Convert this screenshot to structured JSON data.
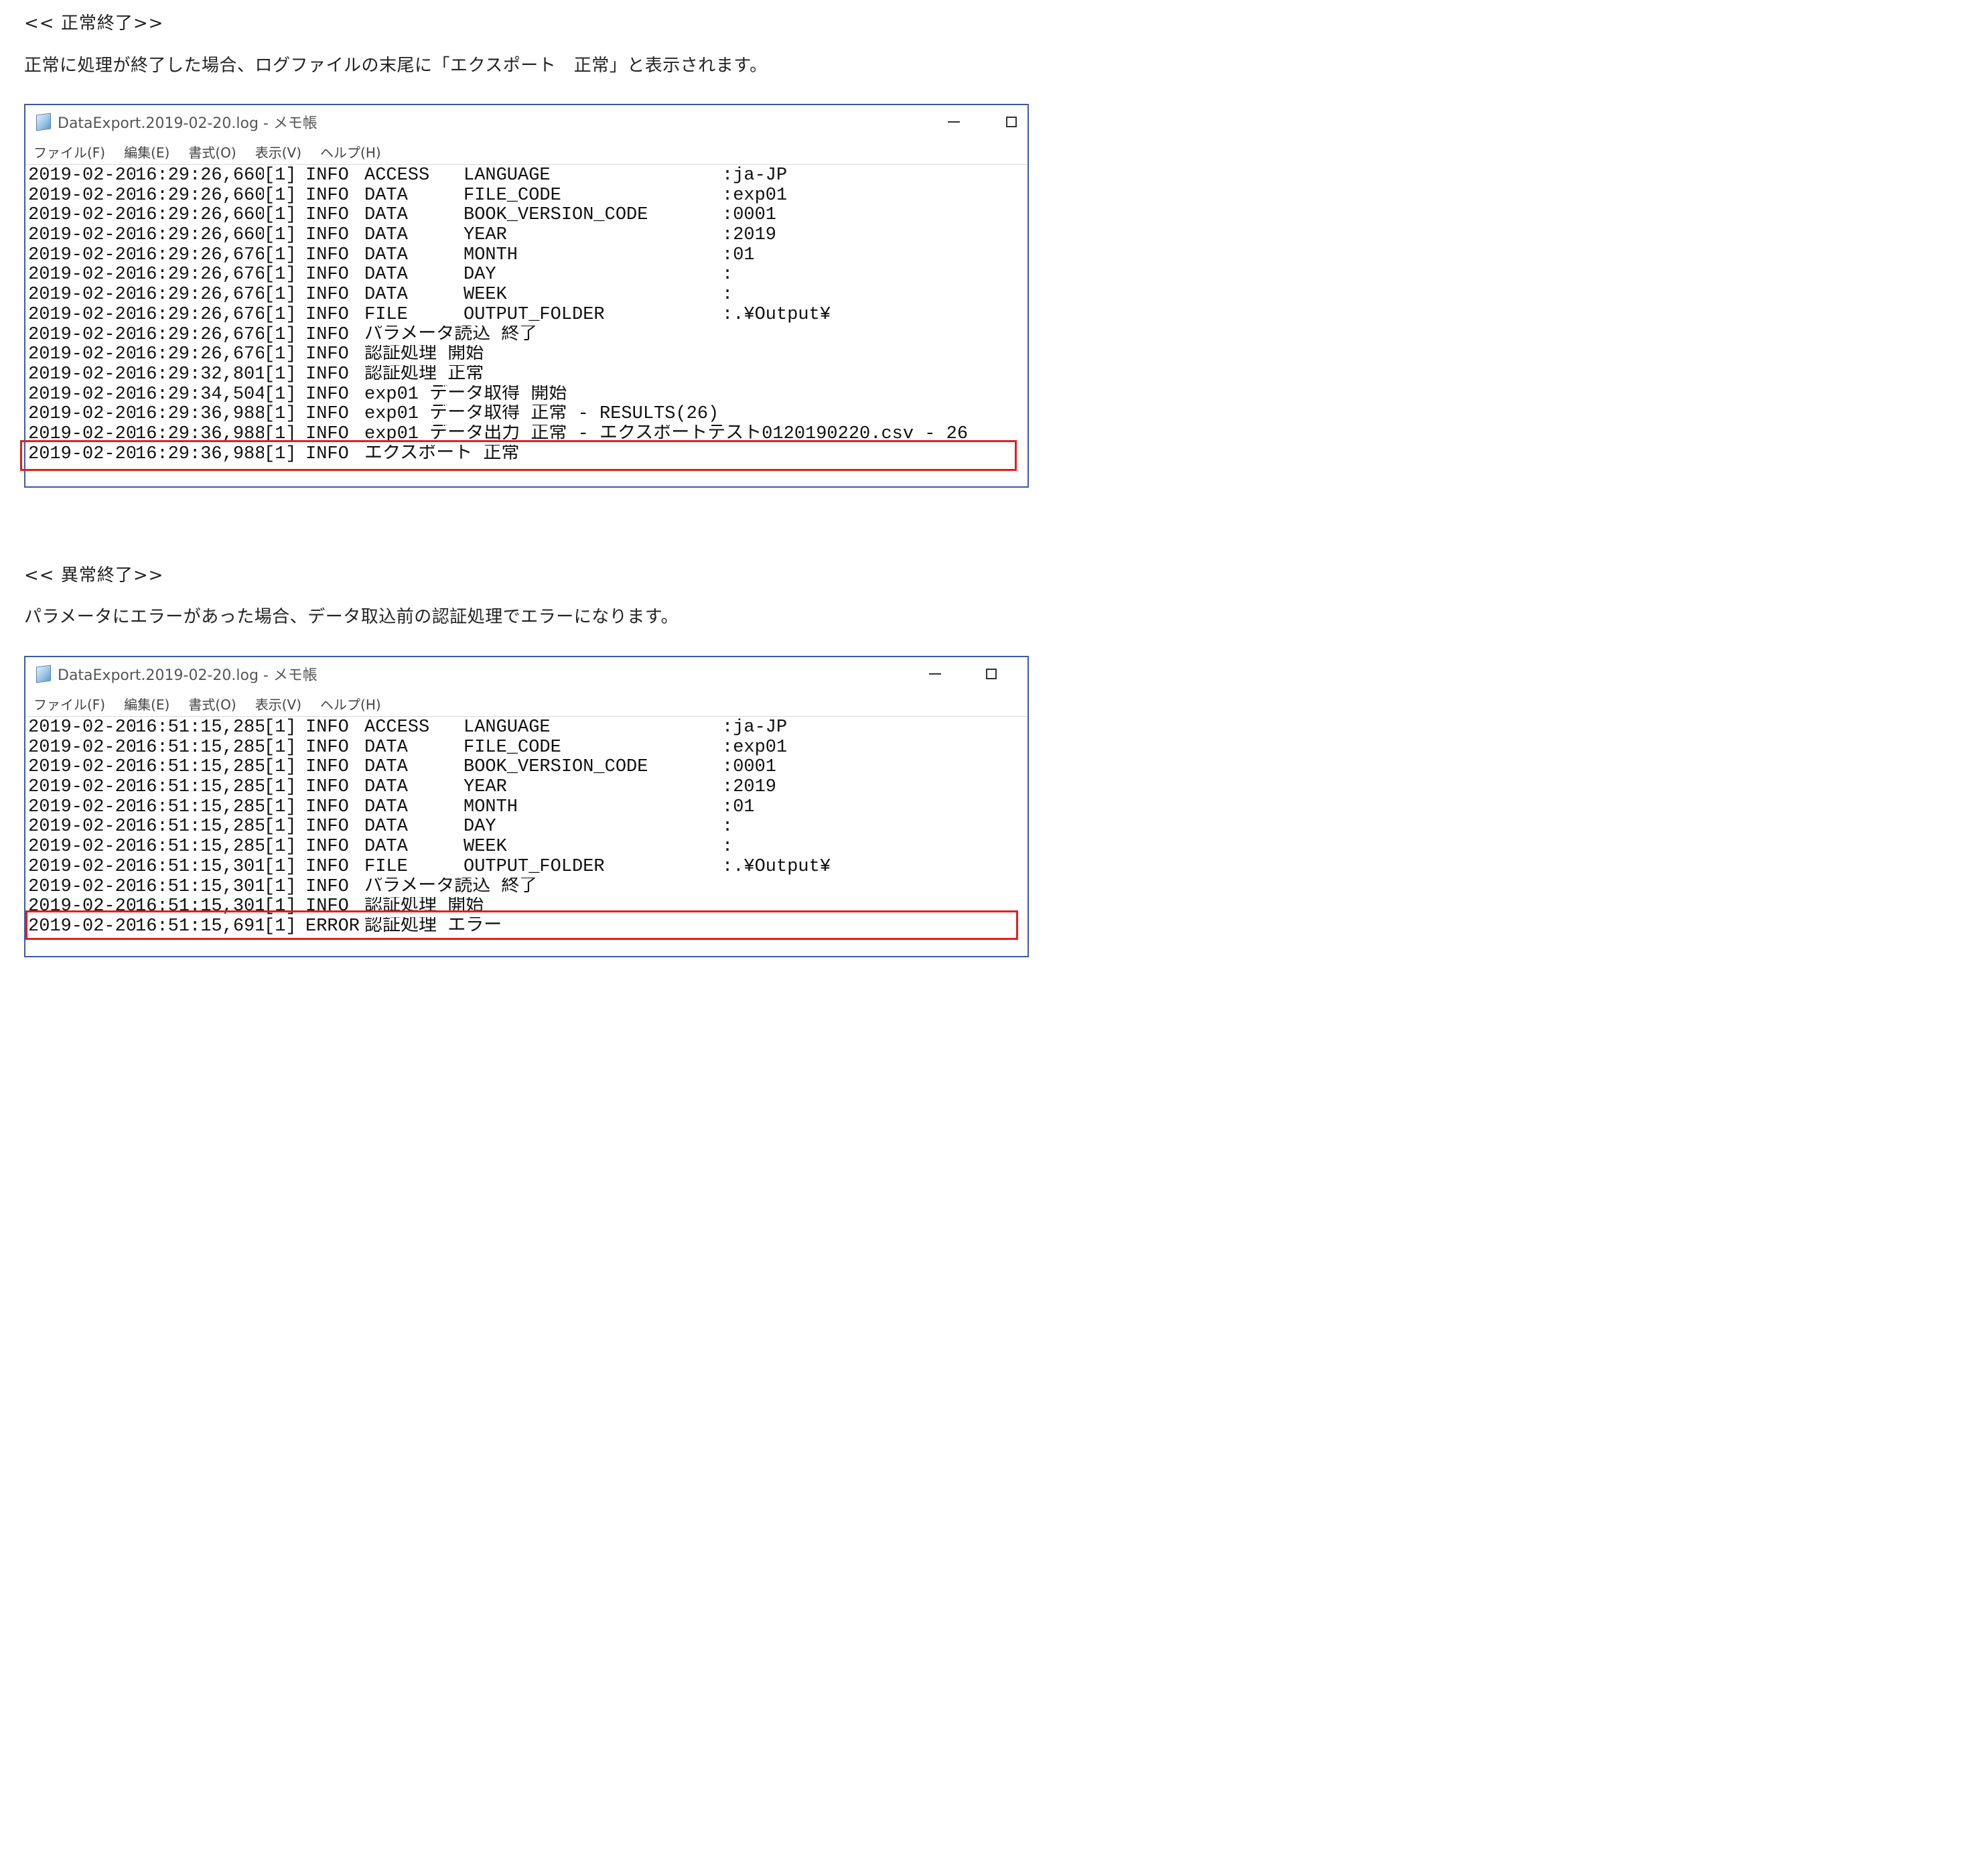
{
  "section1": {
    "heading": "<< 正常終了>>",
    "description": "正常に処理が終了した場合、ログファイルの末尾に「エクスポート　正常」と表示されます。",
    "window": {
      "title": "DataExport.2019-02-20.log - メモ帳",
      "menu": [
        "ファイル(F)",
        "編集(E)",
        "書式(O)",
        "表示(V)",
        "ヘルプ(H)"
      ],
      "lines": [
        {
          "date": "2019-02-20",
          "time": "16:29:26,660",
          "thread": "[1]",
          "level": "INFO",
          "category": "ACCESS",
          "key": "LANGUAGE",
          "value": ":ja-JP"
        },
        {
          "date": "2019-02-20",
          "time": "16:29:26,660",
          "thread": "[1]",
          "level": "INFO",
          "category": "DATA",
          "key": "FILE_CODE",
          "value": ":exp01"
        },
        {
          "date": "2019-02-20",
          "time": "16:29:26,660",
          "thread": "[1]",
          "level": "INFO",
          "category": "DATA",
          "key": "BOOK_VERSION_CODE",
          "value": ":0001"
        },
        {
          "date": "2019-02-20",
          "time": "16:29:26,660",
          "thread": "[1]",
          "level": "INFO",
          "category": "DATA",
          "key": "YEAR",
          "value": ":2019"
        },
        {
          "date": "2019-02-20",
          "time": "16:29:26,676",
          "thread": "[1]",
          "level": "INFO",
          "category": "DATA",
          "key": "MONTH",
          "value": ":01"
        },
        {
          "date": "2019-02-20",
          "time": "16:29:26,676",
          "thread": "[1]",
          "level": "INFO",
          "category": "DATA",
          "key": "DAY",
          "value": ":"
        },
        {
          "date": "2019-02-20",
          "time": "16:29:26,676",
          "thread": "[1]",
          "level": "INFO",
          "category": "DATA",
          "key": "WEEK",
          "value": ":"
        },
        {
          "date": "2019-02-20",
          "time": "16:29:26,676",
          "thread": "[1]",
          "level": "INFO",
          "category": "FILE",
          "key": "OUTPUT_FOLDER",
          "value": ":.¥Output¥"
        },
        {
          "date": "2019-02-20",
          "time": "16:29:26,676",
          "thread": "[1]",
          "level": "INFO",
          "message": "パラメータ読込 終了"
        },
        {
          "date": "2019-02-20",
          "time": "16:29:26,676",
          "thread": "[1]",
          "level": "INFO",
          "message": "認証処理 開始"
        },
        {
          "date": "2019-02-20",
          "time": "16:29:32,801",
          "thread": "[1]",
          "level": "INFO",
          "message": "認証処理 正常"
        },
        {
          "date": "2019-02-20",
          "time": "16:29:34,504",
          "thread": "[1]",
          "level": "INFO",
          "message": "exp01 データ取得 開始"
        },
        {
          "date": "2019-02-20",
          "time": "16:29:36,988",
          "thread": "[1]",
          "level": "INFO",
          "message": "exp01 データ取得 正常 - RESULTS(26)"
        },
        {
          "date": "2019-02-20",
          "time": "16:29:36,988",
          "thread": "[1]",
          "level": "INFO",
          "message": "exp01 データ出力 正常 - エクスポートテスト0120190220.csv - 26"
        },
        {
          "date": "2019-02-20",
          "time": "16:29:36,988",
          "thread": "[1]",
          "level": "INFO",
          "message": "エクスポート 正常"
        }
      ]
    }
  },
  "section2": {
    "heading": "<< 異常終了>>",
    "description": "パラメータにエラーがあった場合、データ取込前の認証処理でエラーになります。",
    "window": {
      "title": "DataExport.2019-02-20.log - メモ帳",
      "menu": [
        "ファイル(F)",
        "編集(E)",
        "書式(O)",
        "表示(V)",
        "ヘルプ(H)"
      ],
      "lines": [
        {
          "date": "2019-02-20",
          "time": "16:51:15,285",
          "thread": "[1]",
          "level": "INFO",
          "category": "ACCESS",
          "key": "LANGUAGE",
          "value": ":ja-JP"
        },
        {
          "date": "2019-02-20",
          "time": "16:51:15,285",
          "thread": "[1]",
          "level": "INFO",
          "category": "DATA",
          "key": "FILE_CODE",
          "value": ":exp01"
        },
        {
          "date": "2019-02-20",
          "time": "16:51:15,285",
          "thread": "[1]",
          "level": "INFO",
          "category": "DATA",
          "key": "BOOK_VERSION_CODE",
          "value": ":0001"
        },
        {
          "date": "2019-02-20",
          "time": "16:51:15,285",
          "thread": "[1]",
          "level": "INFO",
          "category": "DATA",
          "key": "YEAR",
          "value": ":2019"
        },
        {
          "date": "2019-02-20",
          "time": "16:51:15,285",
          "thread": "[1]",
          "level": "INFO",
          "category": "DATA",
          "key": "MONTH",
          "value": ":01"
        },
        {
          "date": "2019-02-20",
          "time": "16:51:15,285",
          "thread": "[1]",
          "level": "INFO",
          "category": "DATA",
          "key": "DAY",
          "value": ":"
        },
        {
          "date": "2019-02-20",
          "time": "16:51:15,285",
          "thread": "[1]",
          "level": "INFO",
          "category": "DATA",
          "key": "WEEK",
          "value": ":"
        },
        {
          "date": "2019-02-20",
          "time": "16:51:15,301",
          "thread": "[1]",
          "level": "INFO",
          "category": "FILE",
          "key": "OUTPUT_FOLDER",
          "value": ":.¥Output¥"
        },
        {
          "date": "2019-02-20",
          "time": "16:51:15,301",
          "thread": "[1]",
          "level": "INFO",
          "message": "パラメータ読込 終了"
        },
        {
          "date": "2019-02-20",
          "time": "16:51:15,301",
          "thread": "[1]",
          "level": "INFO",
          "message": "認証処理 開始"
        },
        {
          "date": "2019-02-20",
          "time": "16:51:15,691",
          "thread": "[1]",
          "level": "ERROR",
          "message": "認証処理 エラー"
        }
      ]
    }
  },
  "colors": {
    "window_border": "#3d5aa6",
    "highlight_border": "#e02020"
  },
  "icons": {
    "app": "notepad-icon",
    "minimize": "minimize-icon",
    "maximize": "maximize-icon"
  }
}
